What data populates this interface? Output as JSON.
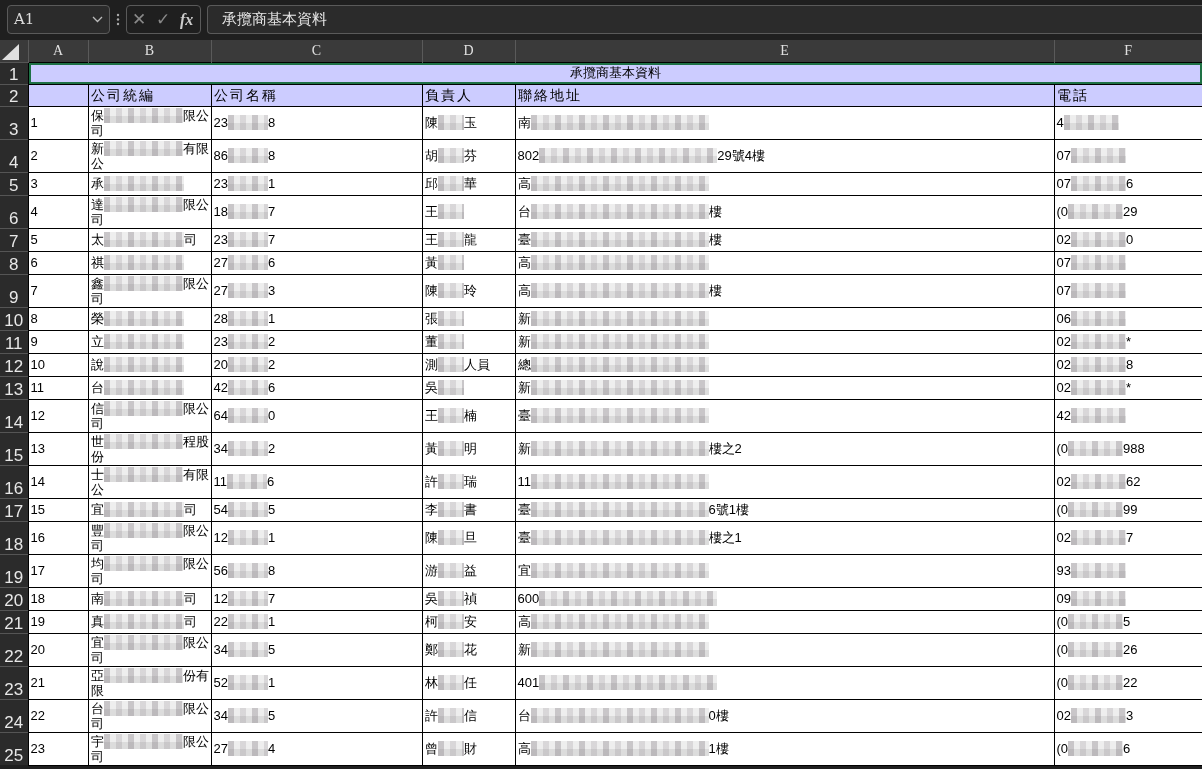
{
  "name_box": {
    "value": "A1"
  },
  "formula_bar": {
    "cancel": "✕",
    "enter": "✓",
    "function": "fx",
    "value": "承攬商基本資料"
  },
  "columns": [
    "A",
    "B",
    "C",
    "D",
    "E",
    "F"
  ],
  "title_row": {
    "number": "1",
    "text": "承攬商基本資料",
    "selected": true
  },
  "header_row": {
    "number": "2",
    "cells": [
      null,
      "公司統編",
      "公司名稱",
      "負責人",
      "聯絡地址",
      "電話"
    ]
  },
  "rows": [
    {
      "number": "3",
      "no": "1",
      "company": {
        "start": "保",
        "end": "限公",
        "line2": "司"
      },
      "id": {
        "start": "23",
        "end": "8"
      },
      "person": {
        "start": "陳",
        "end": "玉"
      },
      "address": {
        "start": "南"
      },
      "phone": {
        "start": "4"
      }
    },
    {
      "number": "4",
      "no": "2",
      "company": {
        "start": "新",
        "end": "有限",
        "line2": "公"
      },
      "id": {
        "start": "86",
        "end": "8"
      },
      "person": {
        "start": "胡",
        "end": "芬"
      },
      "address": {
        "start": "802",
        "end": "29號4樓"
      },
      "phone": {
        "start": "07"
      }
    },
    {
      "number": "5",
      "no": "3",
      "company": {
        "start": "承"
      },
      "id": {
        "start": "23",
        "end": "1"
      },
      "person": {
        "start": "邱",
        "end": "華"
      },
      "address": {
        "start": "高"
      },
      "phone": {
        "start": "07",
        "end": "6"
      }
    },
    {
      "number": "6",
      "no": "4",
      "company": {
        "start": "達",
        "end": "限公",
        "line2": "司"
      },
      "id": {
        "start": "18",
        "end": "7"
      },
      "person": {
        "start": "王"
      },
      "address": {
        "start": "台",
        "end": "樓"
      },
      "phone": {
        "start": "(0",
        "end": "29"
      }
    },
    {
      "number": "7",
      "no": "5",
      "company": {
        "start": "太",
        "end": "司"
      },
      "id": {
        "start": "23",
        "end": "7"
      },
      "person": {
        "start": "王",
        "end": "龍"
      },
      "address": {
        "start": "臺",
        "end": "樓"
      },
      "phone": {
        "start": "02",
        "end": "0"
      }
    },
    {
      "number": "8",
      "no": "6",
      "company": {
        "start": "祺"
      },
      "id": {
        "start": "27",
        "end": "6"
      },
      "person": {
        "start": "黃"
      },
      "address": {
        "start": "高"
      },
      "phone": {
        "start": "07"
      }
    },
    {
      "number": "9",
      "no": "7",
      "company": {
        "start": "鑫",
        "end": "限公",
        "line2": "司"
      },
      "id": {
        "start": "27",
        "end": "3"
      },
      "person": {
        "start": "陳",
        "end": "玲"
      },
      "address": {
        "start": "高",
        "end": "樓"
      },
      "phone": {
        "start": "07"
      }
    },
    {
      "number": "10",
      "no": "8",
      "company": {
        "start": "榮"
      },
      "id": {
        "start": "28",
        "end": "1"
      },
      "person": {
        "start": "張"
      },
      "address": {
        "start": "新"
      },
      "phone": {
        "start": "06"
      }
    },
    {
      "number": "11",
      "no": "9",
      "company": {
        "start": "立"
      },
      "id": {
        "start": "23",
        "end": "2"
      },
      "person": {
        "start": "董"
      },
      "address": {
        "start": "新"
      },
      "phone": {
        "start": "02",
        "end": "*"
      }
    },
    {
      "number": "12",
      "no": "10",
      "company": {
        "start": "說"
      },
      "id": {
        "start": "20",
        "end": "2"
      },
      "person": {
        "start": "測",
        "end": "人員"
      },
      "address": {
        "start": "總"
      },
      "phone": {
        "start": "02",
        "end": "8"
      }
    },
    {
      "number": "13",
      "no": "11",
      "company": {
        "start": "台"
      },
      "id": {
        "start": "42",
        "end": "6"
      },
      "person": {
        "start": "吳"
      },
      "address": {
        "start": "新"
      },
      "phone": {
        "start": "02",
        "end": "*"
      }
    },
    {
      "number": "14",
      "no": "12",
      "company": {
        "start": "信",
        "end": "限公",
        "line2": "司"
      },
      "id": {
        "start": "64",
        "end": "0"
      },
      "person": {
        "start": "王",
        "end": "楠"
      },
      "address": {
        "start": "臺"
      },
      "phone": {
        "start": "42"
      }
    },
    {
      "number": "15",
      "no": "13",
      "company": {
        "start": "世",
        "end": "程股",
        "line2": "份"
      },
      "id": {
        "start": "34",
        "end": "2"
      },
      "person": {
        "start": "黃",
        "end": "明"
      },
      "address": {
        "start": "新",
        "end": "樓之2"
      },
      "phone": {
        "start": "(0",
        "end": "988"
      }
    },
    {
      "number": "16",
      "no": "14",
      "company": {
        "start": "士",
        "end": "有限",
        "line2": "公"
      },
      "id": {
        "start": "11",
        "end": "6"
      },
      "person": {
        "start": "許",
        "end": "瑞"
      },
      "address": {
        "start": "11"
      },
      "phone": {
        "start": "02",
        "end": "62"
      }
    },
    {
      "number": "17",
      "no": "15",
      "company": {
        "start": "宜",
        "end": "司"
      },
      "id": {
        "start": "54",
        "end": "5"
      },
      "person": {
        "start": "李",
        "end": "書"
      },
      "address": {
        "start": "臺",
        "end": "6號1樓"
      },
      "phone": {
        "start": "(0",
        "end": "99"
      }
    },
    {
      "number": "18",
      "no": "16",
      "company": {
        "start": "豐",
        "end": "限公",
        "line2": "司"
      },
      "id": {
        "start": "12",
        "end": "1"
      },
      "person": {
        "start": "陳",
        "end": "旦"
      },
      "address": {
        "start": "臺",
        "end": "樓之1"
      },
      "phone": {
        "start": "02",
        "end": "7"
      }
    },
    {
      "number": "19",
      "no": "17",
      "company": {
        "start": "均",
        "end": "限公",
        "line2": "司"
      },
      "id": {
        "start": "56",
        "end": "8"
      },
      "person": {
        "start": "游",
        "end": "益"
      },
      "address": {
        "start": "宜"
      },
      "phone": {
        "start": "93"
      }
    },
    {
      "number": "20",
      "no": "18",
      "company": {
        "start": "南",
        "end": "司"
      },
      "id": {
        "start": "12",
        "end": "7"
      },
      "person": {
        "start": "吳",
        "end": "禎"
      },
      "address": {
        "start": "600"
      },
      "phone": {
        "start": "09"
      }
    },
    {
      "number": "21",
      "no": "19",
      "company": {
        "start": "真",
        "end": "司"
      },
      "id": {
        "start": "22",
        "end": "1"
      },
      "person": {
        "start": "柯",
        "end": "安"
      },
      "address": {
        "start": "高"
      },
      "phone": {
        "start": "(0",
        "end": "5"
      }
    },
    {
      "number": "22",
      "no": "20",
      "company": {
        "start": "宜",
        "end": "限公",
        "line2": "司"
      },
      "id": {
        "start": "34",
        "end": "5"
      },
      "person": {
        "start": "鄭",
        "end": "花"
      },
      "address": {
        "start": "新"
      },
      "phone": {
        "start": "(0",
        "end": "26"
      }
    },
    {
      "number": "23",
      "no": "21",
      "company": {
        "start": "亞",
        "end": "份有",
        "line2": "限"
      },
      "id": {
        "start": "52",
        "end": "1"
      },
      "person": {
        "start": "林",
        "end": "任"
      },
      "address": {
        "start": "401"
      },
      "phone": {
        "start": "(0",
        "end": "22"
      }
    },
    {
      "number": "24",
      "no": "22",
      "company": {
        "start": "台",
        "end": "限公",
        "line2": "司"
      },
      "id": {
        "start": "34",
        "end": "5"
      },
      "person": {
        "start": "許",
        "end": "信"
      },
      "address": {
        "start": "台",
        "end": "0樓"
      },
      "phone": {
        "start": "02",
        "end": "3"
      }
    },
    {
      "number": "25",
      "no": "23",
      "company": {
        "start": "宇",
        "end": "限公",
        "line2": "司"
      },
      "id": {
        "start": "27",
        "end": "4"
      },
      "person": {
        "start": "曾",
        "end": "財"
      },
      "address": {
        "start": "高",
        "end": "1樓"
      },
      "phone": {
        "start": "(0",
        "end": "6"
      }
    }
  ]
}
